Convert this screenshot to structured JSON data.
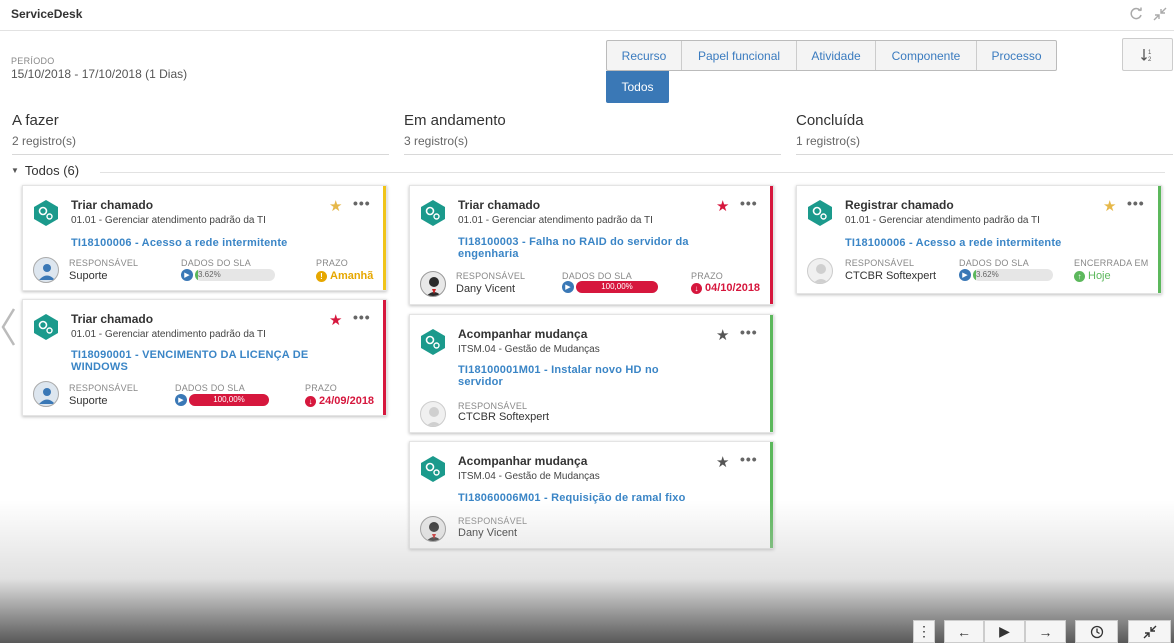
{
  "app": {
    "title": "ServiceDesk"
  },
  "periodo": {
    "label": "PERÍODO",
    "value": "15/10/2018 - 17/10/2018 (1 Dias)"
  },
  "filters": {
    "tabs": [
      "Recurso",
      "Papel funcional",
      "Atividade",
      "Componente",
      "Processo"
    ],
    "active": "Todos"
  },
  "columns": [
    {
      "title": "A fazer",
      "count": "2 registro(s)"
    },
    {
      "title": "Em andamento",
      "count": "3 registro(s)"
    },
    {
      "title": "Concluída",
      "count": "1 registro(s)"
    }
  ],
  "group": {
    "label": "Todos (6)"
  },
  "cards": [
    {
      "title": "Triar chamado",
      "subtitle": "01.01 - Gerenciar atendimento padrão da TI",
      "link": "TI18100006 - Acesso a rede intermitente",
      "resp_label": "RESPONSÁVEL",
      "resp": "Suporte",
      "sla_label": "DADOS DO SLA",
      "sla_value": "3.62%",
      "prazo_label": "PRAZO",
      "prazo": "Amanhã",
      "star_color": "#e6b84a",
      "bar_color": "#f0c419"
    },
    {
      "title": "Triar chamado",
      "subtitle": "01.01 - Gerenciar atendimento padrão da TI",
      "link": "TI18090001 - VENCIMENTO DA LICENÇA DE WINDOWS",
      "resp_label": "RESPONSÁVEL",
      "resp": "Suporte",
      "sla_label": "DADOS DO SLA",
      "sla_value": "100,00%",
      "prazo_label": "PRAZO",
      "prazo": "24/09/2018",
      "star_color": "#d6173d",
      "bar_color": "#d6173d"
    },
    {
      "title": "Triar chamado",
      "subtitle": "01.01 - Gerenciar atendimento padrão da TI",
      "link": "TI18100003 - Falha no RAID do servidor da engenharia",
      "resp_label": "RESPONSÁVEL",
      "resp": "Dany Vicent",
      "sla_label": "DADOS DO SLA",
      "sla_value": "100,00%",
      "prazo_label": "PRAZO",
      "prazo": "04/10/2018",
      "star_color": "#d6173d",
      "bar_color": "#d6173d"
    },
    {
      "title": "Acompanhar mudança",
      "subtitle": "ITSM.04 - Gestão de Mudanças",
      "link": "TI18100001M01 - Instalar novo HD no servidor",
      "resp_label": "RESPONSÁVEL",
      "resp": "CTCBR Softexpert",
      "star_color": "#555555",
      "bar_color": "#5cb85c"
    },
    {
      "title": "Acompanhar mudança",
      "subtitle": "ITSM.04 - Gestão de Mudanças",
      "link": "TI18060006M01 - Requisição de ramal fixo",
      "resp_label": "RESPONSÁVEL",
      "resp": "Dany Vicent",
      "star_color": "#555555",
      "bar_color": "#5cb85c"
    },
    {
      "title": "Registrar chamado",
      "subtitle": "01.01 - Gerenciar atendimento padrão da TI",
      "link": "TI18100006 - Acesso a rede intermitente",
      "resp_label": "RESPONSÁVEL",
      "resp": "CTCBR Softexpert",
      "sla_label": "DADOS DO SLA",
      "sla_value": "3.62%",
      "enc_label": "ENCERRADA EM",
      "enc": "Hoje",
      "star_color": "#e6b84a",
      "bar_color": "#5cb85c"
    }
  ],
  "colors": {
    "accent": "#3a78b6",
    "link": "#3a85c6",
    "late": "#d6173d",
    "warn": "#e6a700",
    "done": "#5cb85c",
    "gear": "#1b9a8c"
  }
}
